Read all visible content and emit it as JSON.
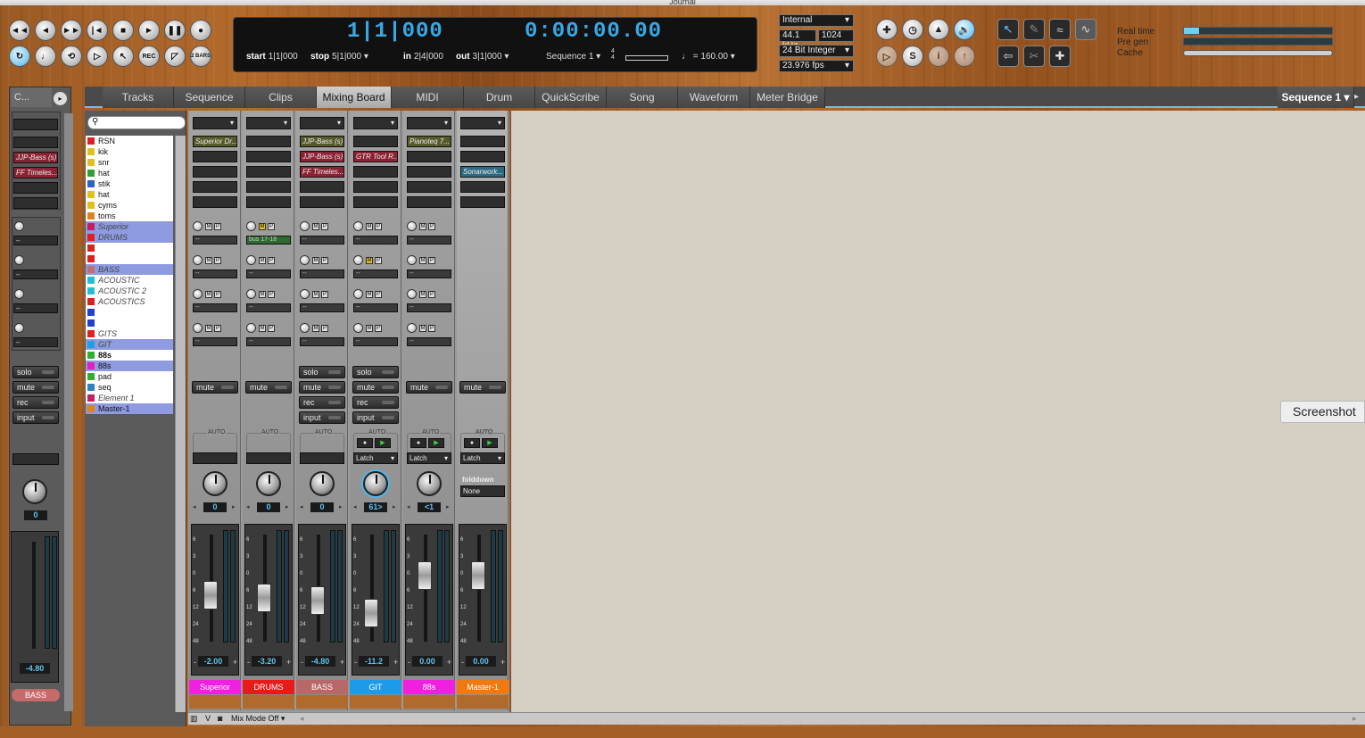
{
  "window": {
    "title": "Journal"
  },
  "transport": {
    "rewind": "◄◄",
    "back": "◄",
    "forward": "►►",
    "to_start": "|◄",
    "stop": "■",
    "play": "►",
    "pause": "❚❚",
    "record": "●",
    "two_bars": "2 BARS",
    "rec": "REC"
  },
  "counter": {
    "bars": "1|1|000",
    "time": "0:00:00.00",
    "start_label": "start",
    "start": "1|1|000",
    "stop_label": "stop",
    "stop": "5|1|000",
    "in_label": "in",
    "in": "2|4|000",
    "out_label": "out",
    "out": "3|1|000",
    "sequence": "Sequence 1",
    "meter_top": "4",
    "meter_bottom": "4",
    "tempo_prefix": "=",
    "tempo": "160.00"
  },
  "engine": {
    "clock": "Internal",
    "sample_rate": "44.1 kHz",
    "buffer": "1024",
    "bit_depth": "24 Bit Integer",
    "fps": "23.976 fps"
  },
  "perf": {
    "realtime_label": "Real time",
    "pregen_label": "Pre gen",
    "cache_label": "Cache",
    "realtime_level": 0.1,
    "pregen_level": 0.0,
    "cache_level": 0.0
  },
  "tabs": [
    {
      "label": "Tracks"
    },
    {
      "label": "Sequence"
    },
    {
      "label": "Clips"
    },
    {
      "label": "Mixing Board"
    },
    {
      "label": "MIDI"
    },
    {
      "label": "Drum"
    },
    {
      "label": "QuickScribe"
    },
    {
      "label": "Song"
    },
    {
      "label": "Waveform"
    },
    {
      "label": "Meter Bridge"
    }
  ],
  "sequence_menu": "Sequence 1",
  "left_tab": "C...",
  "tracks": [
    {
      "name": "RSN",
      "color": "#e02020"
    },
    {
      "name": "kik",
      "color": "#e0c020"
    },
    {
      "name": "snr",
      "color": "#e0c020"
    },
    {
      "name": "hat",
      "color": "#30a030"
    },
    {
      "name": "stik",
      "color": "#3060c0"
    },
    {
      "name": "hat",
      "color": "#e0c020"
    },
    {
      "name": "cyms",
      "color": "#e0c020"
    },
    {
      "name": "toms",
      "color": "#e08020"
    },
    {
      "name": "Superior",
      "color": "#c02060"
    },
    {
      "name": "DRUMS",
      "color": "#e02020"
    },
    {
      "name": "",
      "color": "#e02020"
    },
    {
      "name": "",
      "color": "#e02020"
    },
    {
      "name": "BASS",
      "color": "#c07070"
    },
    {
      "name": "ACOUSTIC",
      "color": "#20c0d0"
    },
    {
      "name": "ACOUSTIC 2",
      "color": "#20c0d0"
    },
    {
      "name": "ACOUSTICS",
      "color": "#e02020"
    },
    {
      "name": "",
      "color": "#2040d0"
    },
    {
      "name": "",
      "color": "#2040d0"
    },
    {
      "name": "GITS",
      "color": "#e02020"
    },
    {
      "name": "GIT",
      "color": "#20a0e0"
    },
    {
      "name": "88s",
      "color": "#30b030"
    },
    {
      "name": "88s",
      "color": "#e020c0"
    },
    {
      "name": "pad",
      "color": "#30b030"
    },
    {
      "name": "seq",
      "color": "#3080c0"
    },
    {
      "name": "Element 1",
      "color": "#c02060"
    },
    {
      "name": "Master-1",
      "color": "#e08020"
    }
  ],
  "left_strip": {
    "insert1": "JJP-Bass (s)",
    "insert2": "FF Timeles...",
    "solo": "solo",
    "mute": "mute",
    "rec": "rec",
    "input": "input",
    "pan": "0",
    "fader": "-4.80",
    "name": "BASS",
    "send_val": "--"
  },
  "strip_labels": {
    "solo": "solo",
    "mute": "mute",
    "rec": "rec",
    "input": "input",
    "auto": "AUTO",
    "latch": "Latch",
    "m": "M",
    "p": "P",
    "send_empty": "--"
  },
  "channels": [
    {
      "name": "Superior",
      "color": "#f020e0",
      "insert": "Superior Dr...",
      "pan": "0",
      "fader": "-2.00",
      "fader_pos": 0.52
    },
    {
      "name": "DRUMS",
      "color": "#e81a1a",
      "bus": "bus 17-18",
      "pan": "0",
      "fader": "-3.20",
      "fader_pos": 0.55
    },
    {
      "name": "BASS",
      "color": "#b86868",
      "insert": "JJP-Bass (s)",
      "insert2": "FF Timeles...",
      "pan": "0",
      "fader": "-4.80",
      "fader_pos": 0.58
    },
    {
      "name": "GIT",
      "color": "#1c9be8",
      "insert2": "GTR Tool R...",
      "pan": "61>",
      "fader": "-11.2",
      "fader_pos": 0.72
    },
    {
      "name": "88s",
      "color": "#f020e0",
      "insert": "Pianoteq 7...",
      "pan": "<1",
      "fader": "0.00",
      "fader_pos": 0.3
    },
    {
      "name": "Master-1",
      "color": "#f07a10",
      "insert3": "Sonarwork...",
      "fader": "0.00",
      "fader_pos": 0.3,
      "folddown": "folddown",
      "folddown_val": "None"
    }
  ],
  "meter_ticks": [
    "6",
    "3",
    "0",
    "6",
    "12",
    "24",
    "48"
  ],
  "bottom": {
    "v": "V",
    "mixmode": "Mix Mode Off"
  },
  "screenshot_btn": "Screenshot"
}
